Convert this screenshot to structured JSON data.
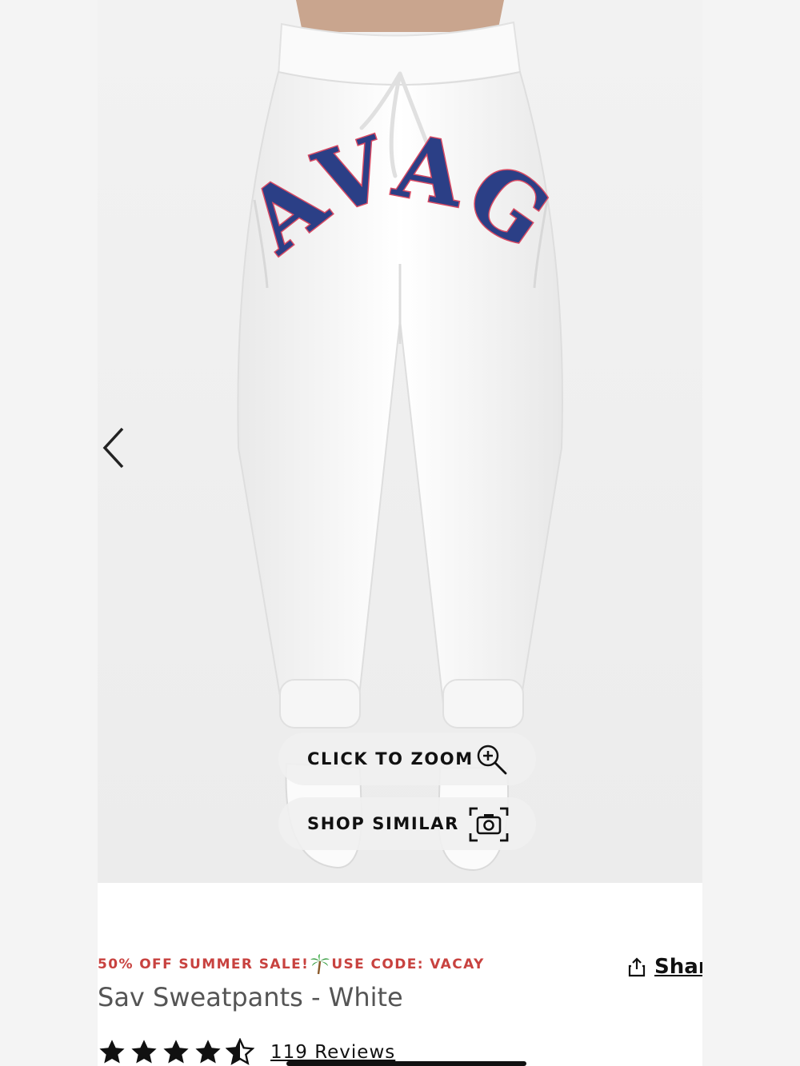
{
  "gallery": {
    "print_text": "SAVAGE",
    "zoom_label": "CLICK TO ZOOM",
    "similar_label": "SHOP SIMILAR"
  },
  "promo": {
    "sale_text": "50% OFF SUMMER SALE!",
    "code_text": "USE CODE: VACAY",
    "icon": "palm-tree-icon"
  },
  "share": {
    "label": "Shar"
  },
  "product": {
    "title": "Sav Sweatpants - White",
    "rating": 4.5,
    "rating_max": 5,
    "reviews_label": "119 Reviews"
  },
  "colors": {
    "promo_red": "#c8423f",
    "print_navy": "#2b3f86",
    "print_outline": "#d84a63"
  }
}
